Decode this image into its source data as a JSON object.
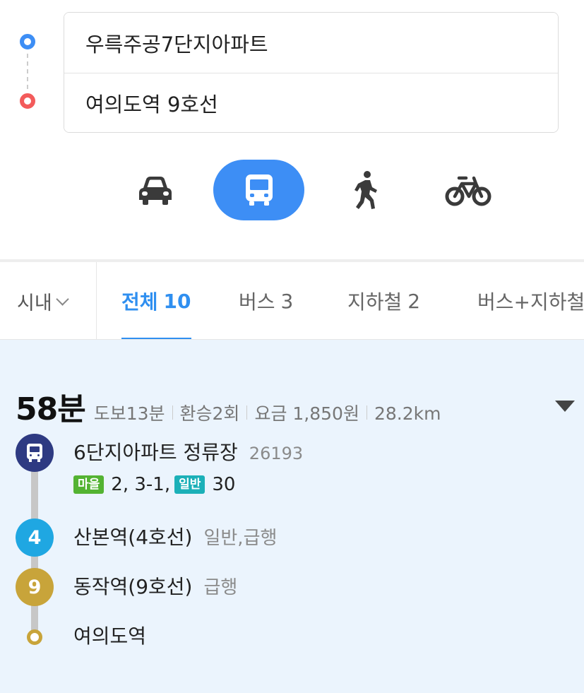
{
  "route": {
    "origin": "우륵주공7단지아파트",
    "destination": "여의도역 9호선"
  },
  "modes": [
    {
      "name": "car",
      "icon": "car-icon",
      "active": false
    },
    {
      "name": "transit",
      "icon": "bus-icon",
      "active": true
    },
    {
      "name": "walk",
      "icon": "walk-icon",
      "active": false
    },
    {
      "name": "bike",
      "icon": "bike-icon",
      "active": false
    }
  ],
  "colors": {
    "accent": "#3d8ef5",
    "origin": "#3d8ef5",
    "destination": "#f35b5b",
    "line4": "#1fa7e2",
    "line9": "#c8a43a",
    "bus": "#2e3a82",
    "badge_village": "#53b332",
    "badge_regular": "#1bb0b8",
    "panel_bg": "#ebf4fd"
  },
  "tabs": {
    "region": "시내",
    "items": [
      {
        "label": "전체",
        "count": "10",
        "active": true
      },
      {
        "label": "버스",
        "count": "3",
        "active": false
      },
      {
        "label": "지하철",
        "count": "2",
        "active": false
      },
      {
        "label": "버스+지하철",
        "count": "",
        "active": false
      }
    ]
  },
  "result": {
    "duration": "58분",
    "walk": "도보13분",
    "transfer": "환승2회",
    "fare": "요금 1,850원",
    "distance": "28.2km",
    "steps": [
      {
        "name": "6단지아파트 정류장",
        "sub": "26193",
        "icon": "bus-stop-icon"
      },
      {
        "name": "산본역(4호선)",
        "sub": "일반,급행",
        "badge": "4"
      },
      {
        "name": "동작역(9호선)",
        "sub": "급행",
        "badge": "9"
      },
      {
        "name": "여의도역"
      }
    ],
    "bus_lines": {
      "village_label": "마을",
      "village_numbers": "2, 3-1,",
      "regular_label": "일반",
      "regular_numbers": "30"
    }
  }
}
